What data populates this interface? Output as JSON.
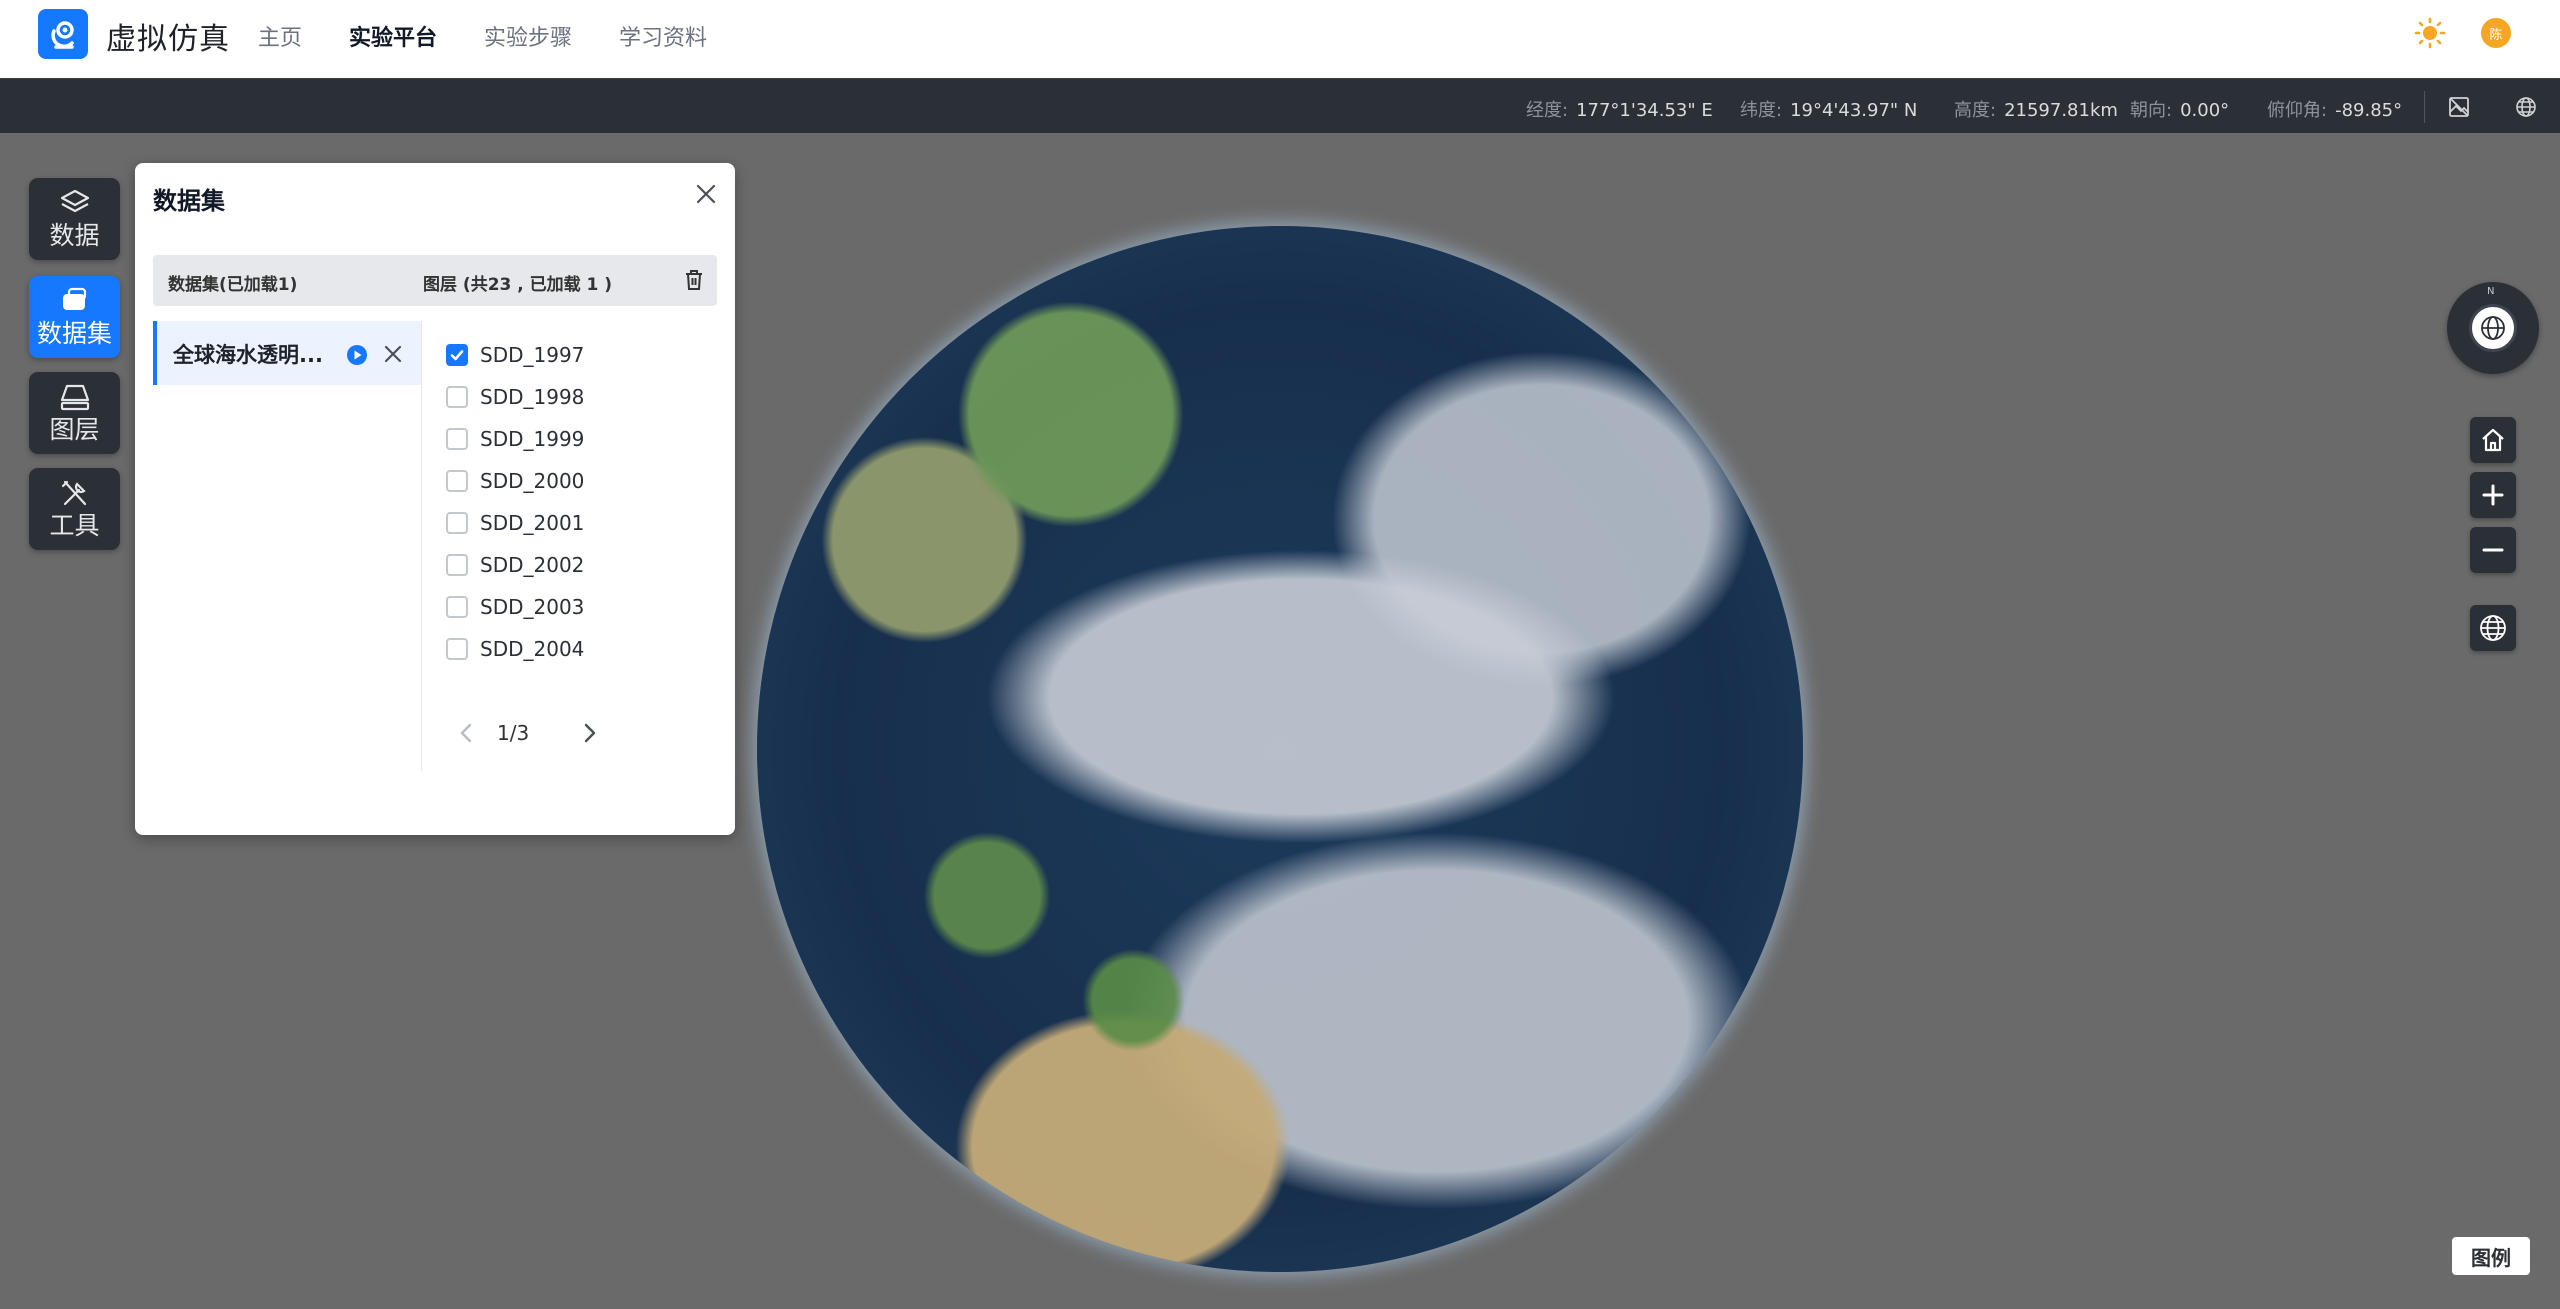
{
  "app": {
    "title": "虚拟仿真",
    "avatar_text": "陈"
  },
  "nav": {
    "items": [
      "主页",
      "实验平台",
      "实验步骤",
      "学习资料"
    ],
    "active_index": 1
  },
  "statusbar": {
    "longitude": {
      "label": "经度:",
      "value": "177°1'34.53\" E"
    },
    "latitude": {
      "label": "纬度:",
      "value": "19°4'43.97\" N"
    },
    "height": {
      "label": "高度:",
      "value": "21597.81km"
    },
    "heading": {
      "label": "朝向:",
      "value": "0.00°"
    },
    "pitch": {
      "label": "俯仰角:",
      "value": "-89.85°"
    }
  },
  "rail": {
    "items": [
      {
        "label": "数据",
        "icon": "layers-icon",
        "active": false
      },
      {
        "label": "数据集",
        "icon": "dataset-icon",
        "active": true
      },
      {
        "label": "图层",
        "icon": "layer-panel-icon",
        "active": false
      },
      {
        "label": "工具",
        "icon": "tools-icon",
        "active": false
      }
    ]
  },
  "panel": {
    "title": "数据集",
    "header_left": "数据集(已加载1)",
    "header_right": "图层 (共23 , 已加载 1 )",
    "dataset_name": "全球海水透明...",
    "layers": [
      {
        "name": "SDD_1997",
        "checked": true
      },
      {
        "name": "SDD_1998",
        "checked": false
      },
      {
        "name": "SDD_1999",
        "checked": false
      },
      {
        "name": "SDD_2000",
        "checked": false
      },
      {
        "name": "SDD_2001",
        "checked": false
      },
      {
        "name": "SDD_2002",
        "checked": false
      },
      {
        "name": "SDD_2003",
        "checked": false
      },
      {
        "name": "SDD_2004",
        "checked": false
      }
    ],
    "pager": "1/3"
  },
  "compass": {
    "north": "N"
  },
  "legend_label": "图例",
  "colors": {
    "accent": "#1677ff",
    "dark_panel": "#2b2f36",
    "map_bg": "#6a6a6a",
    "sun": "#f5a623"
  }
}
